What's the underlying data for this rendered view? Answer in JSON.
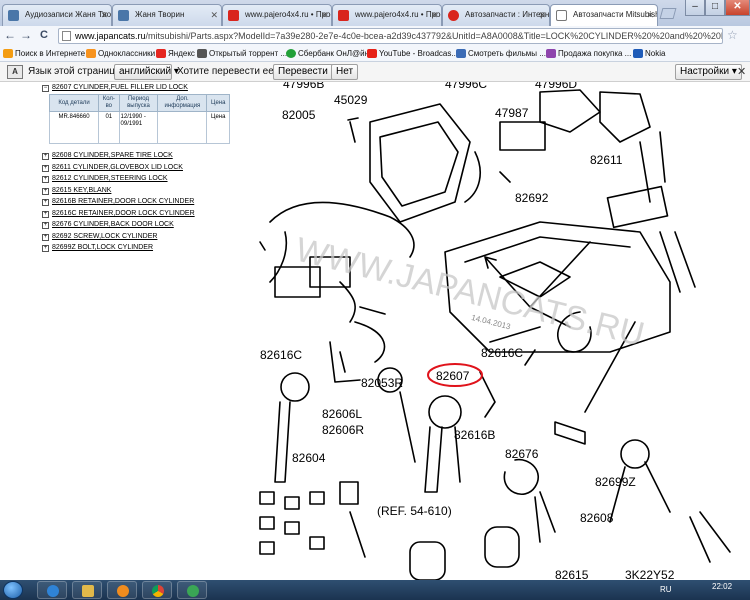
{
  "tabs": [
    {
      "title": "Аудиозаписи Жаня Твор",
      "icon": "vk-icon",
      "color": "#4a76a8"
    },
    {
      "title": "Жаня Творин",
      "icon": "vk-icon",
      "color": "#4a76a8"
    },
    {
      "title": "www.pajero4x4.ru • Прос",
      "icon": "mitsubishi-icon",
      "color": "#d9251d"
    },
    {
      "title": "www.pajero4x4.ru • Прос",
      "icon": "mitsubishi-icon",
      "color": "#d9251d"
    },
    {
      "title": "Автозапчасти : Интернет",
      "icon": "parts-icon",
      "color": "#d9251d"
    },
    {
      "title": "Автозапчасти Mitsubish",
      "icon": "page-icon",
      "color": "#ffffff"
    }
  ],
  "window_controls": {
    "minimize": "–",
    "maximize": "□",
    "close": "✕"
  },
  "nav": {
    "back": "←",
    "forward": "→",
    "reload": "C",
    "home": "⌂",
    "url_host": "www.japancats.ru",
    "url_rest": "/mitsubishi/Parts.aspx?ModelId=7a39e280-2e7e-4c0e-bcea-a2d39c437792&UnitId=A8A0008&Title=LOCK%20CYLINDER%20%20and%20%20KEY"
  },
  "bookmarks": [
    {
      "label": "Поиск в Интернете",
      "color": "#f39c12"
    },
    {
      "label": "Одноклассники",
      "color": "#f7931e"
    },
    {
      "label": "Яндекс",
      "color": "#e52620"
    },
    {
      "label": "Открытый торрент ...",
      "color": "#555555"
    },
    {
      "label": "Сбербанк ОнЛ@йн",
      "color": "#21a038"
    },
    {
      "label": "YouTube - Broadcas...",
      "color": "#e62117"
    },
    {
      "label": "Смотреть фильмы ...",
      "color": "#3b6bb5"
    },
    {
      "label": "Продажа покупка ...",
      "color": "#8e44ad"
    },
    {
      "label": "Nokia",
      "color": "#1e5bb8"
    }
  ],
  "translate": {
    "prompt": "Язык этой страницы",
    "language": "английский",
    "question": "Хотите перевести ее?",
    "translate_btn": "Перевести",
    "no_btn": "Нет",
    "settings_btn": "Настройки",
    "close": "✕"
  },
  "parts": {
    "selected": "82607 CYLINDER,FUEL FILLER LID LOCK",
    "table_headers": [
      "Код детали",
      "Кол-во",
      "Период выпуска",
      "Доп. информация",
      "Цена"
    ],
    "table_row": {
      "code": "MR.846660",
      "qty": "01",
      "period": "12/1990 - 09/1991",
      "info": "",
      "price": "Цена"
    },
    "list": [
      "82608 CYLINDER,SPARE TIRE LOCK",
      "82611 CYLINDER,GLOVEBOX LID LOCK",
      "82612 CYLINDER,STEERING LOCK",
      "82615 KEY,BLANK",
      "82616B RETAINER,DOOR LOCK CYLINDER",
      "82616C RETAINER,DOOR LOCK CYLINDER",
      "82676 CYLINDER,BACK DOOR LOCK",
      "82692 SCREW,LOCK CYLINDER",
      "82699Z BOLT,LOCK CYLINDER"
    ]
  },
  "diagram": {
    "labels": {
      "p47996B": "47996B",
      "p47996C": "47996C",
      "p47996D": "47996D",
      "p45029": "45029",
      "p82005": "82005",
      "p47987": "47987",
      "p82611": "82611",
      "p82692": "82692",
      "p82616C_left": "82616C",
      "p82616C_right": "82616C",
      "p82607": "82607",
      "p82053R": "82053R",
      "p82606L": "82606L",
      "p82606R": "82606R",
      "p82616B": "82616B",
      "p82604": "82604",
      "p82676": "82676",
      "p82699Z": "82699Z",
      "p82608": "82608",
      "ref": "(REF. 54-610)",
      "p82615": "82615",
      "code": "3K22Y52"
    },
    "watermark": "WWW.JAPANCATS.RU",
    "date_stamp": "14.04.2013"
  },
  "taskbar": {
    "lang": "RU",
    "time": "22:02"
  }
}
